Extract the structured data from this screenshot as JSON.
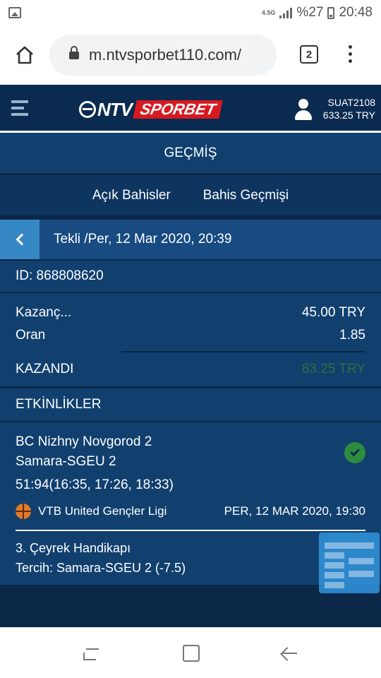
{
  "status_bar": {
    "network": "4.5G",
    "battery": "%27",
    "time": "20:48"
  },
  "browser": {
    "url": "m.ntvsporbet110.com/",
    "tab_count": "2"
  },
  "site": {
    "logo_ntv": "NTV",
    "logo_sportbet": "SPORBET",
    "username": "SUAT2108",
    "balance": "633.25 TRY"
  },
  "page": {
    "title": "GEÇMİŞ",
    "tabs": [
      "Açık Bahisler",
      "Bahis Geçmişi"
    ]
  },
  "bet": {
    "header": "Tekli /Per, 12 Mar 2020, 20:39",
    "id_label": "ID: 868808620",
    "stake_label": "Kazanç...",
    "stake_value": "45.00 TRY",
    "odds_label": "Oran",
    "odds_value": "1.85",
    "result_label": "KAZANDI",
    "result_value": "83.25 TRY",
    "result_color": "#2f6e3f"
  },
  "events": {
    "title": "ETKİNLİKLER",
    "items": [
      {
        "team_home": "BC Nizhny Novgorod 2",
        "team_away": "Samara-SGEU 2",
        "score": "51:94(16:35, 17:26, 18:33)",
        "sport_icon": "basketball-icon",
        "league": "VTB United Gençler Ligi",
        "date": "PER, 12 MAR 2020, 19:30",
        "market": "3. Çeyrek Handikapı",
        "selection": "Tercih: Samara-SGEU 2 (-7.5)",
        "status_icon": "check-icon"
      }
    ]
  },
  "colors": {
    "brand_dark": "#0b2a50",
    "brand_panel": "#11406f",
    "accent_blue": "#3688c4",
    "brand_red": "#d71920",
    "success_green": "#2c8b3f"
  }
}
